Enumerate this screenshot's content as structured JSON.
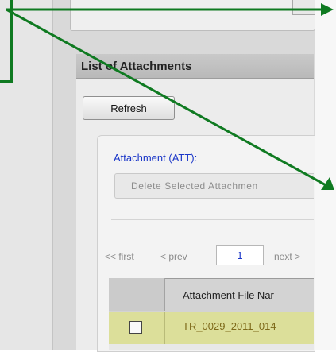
{
  "section": {
    "title": "List of Attachments",
    "refresh_label": "Refresh"
  },
  "attachment_panel": {
    "label": "Attachment (ATT):",
    "delete_label": "Delete Selected Attachmen"
  },
  "pager": {
    "first": "<< first",
    "prev": "< prev",
    "page": "1",
    "next": "next >"
  },
  "table": {
    "headers": [
      "",
      "Attachment File Nar"
    ],
    "rows": [
      {
        "checked": false,
        "file_name": "TR_0029_2011_014"
      }
    ]
  },
  "colors": {
    "annotation": "#0f7a21",
    "link": "#1a36c8",
    "row_highlight": "#dcdf9a"
  },
  "annotation": {
    "type": "arrow-lines",
    "color": "#0f7a21"
  }
}
